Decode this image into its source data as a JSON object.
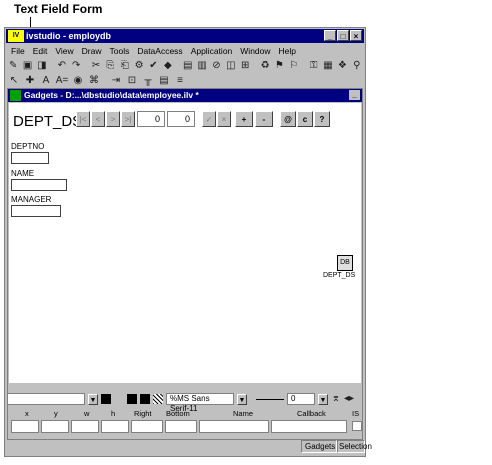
{
  "caption": "Text Field Form",
  "app": {
    "title": "ivstudio - employdb",
    "logo": "IV",
    "window_buttons": [
      "_",
      "□",
      "×"
    ]
  },
  "menu": [
    "File",
    "Edit",
    "View",
    "Draw",
    "Tools",
    "DataAccess",
    "Application",
    "Window",
    "Help"
  ],
  "toolbar1_icons": [
    "✎",
    "▣",
    "◨",
    "|",
    "↶",
    "↷",
    "|",
    "✂",
    "⎘",
    "⎗",
    "⚙",
    "✔",
    "◆",
    "|",
    "▤",
    "▥",
    "⊘",
    "◫",
    "⊞",
    "|",
    "♻",
    "⚑",
    "⚐",
    "|",
    "⚿",
    "▦",
    "❖",
    "⚲"
  ],
  "toolbar2_icons": [
    "↖",
    "✚",
    "A",
    "A=",
    "◉",
    "⌘",
    "|",
    "⇥",
    "⊡",
    "╥",
    "▤",
    "≡"
  ],
  "doc": {
    "title": "Gadgets - D:...\\dbstudio\\data\\employee.ilv *",
    "minimize": "_",
    "dept_ds_label": "DEPT_DS",
    "nav_first": "|<",
    "nav_prev": "<",
    "nav_next": ">",
    "nav_last": ">|",
    "nav_value1": "0",
    "nav_value2": "0",
    "nav_ok": "✓",
    "nav_cancel": "×",
    "nav_insert": "+",
    "nav_delete": "-",
    "nav_query": "@",
    "nav_clear": "c",
    "nav_help": "?",
    "fields": [
      {
        "label": "DEPTNO"
      },
      {
        "label": "NAME"
      },
      {
        "label": "MANAGER"
      }
    ],
    "ds_icon_label": "DEPT_DS",
    "ds_icon_glyph": "DB"
  },
  "props": {
    "font": "%MS Sans Serif-11",
    "size": "0",
    "headers": [
      "x",
      "y",
      "w",
      "h",
      "Right",
      "Bottom",
      "Name",
      "Callback",
      "IS"
    ]
  },
  "status": {
    "left": "Gadgets",
    "right": "Selection"
  }
}
